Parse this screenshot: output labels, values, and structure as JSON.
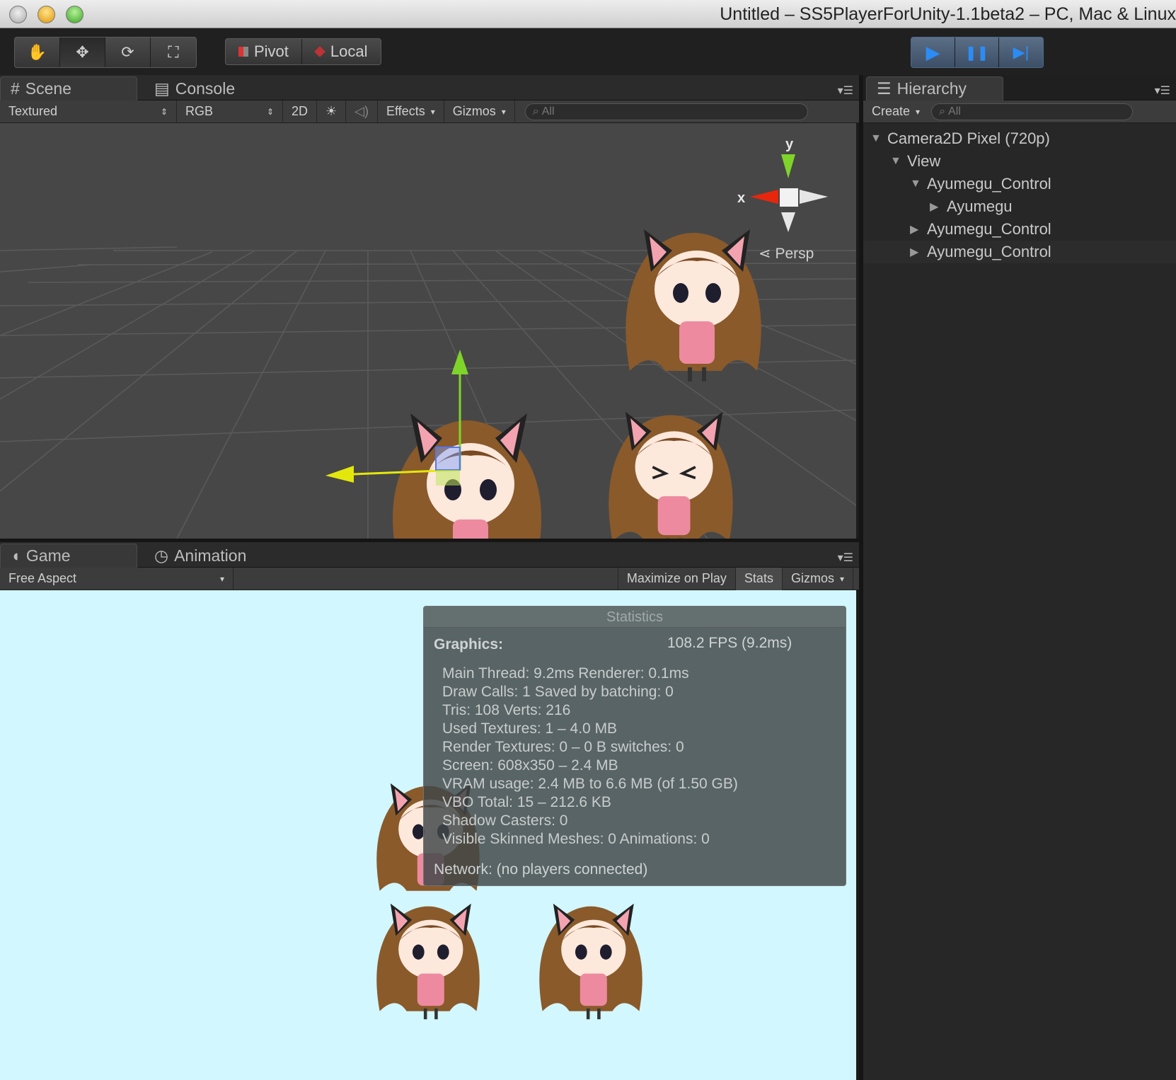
{
  "window": {
    "title": "Untitled – SS5PlayerForUnity-1.1beta2 – PC, Mac & Linux"
  },
  "toolbar": {
    "tools": [
      {
        "name": "hand-tool",
        "glyph": "✋"
      },
      {
        "name": "move-tool",
        "glyph": "✥"
      },
      {
        "name": "rotate-tool",
        "glyph": "⟳"
      },
      {
        "name": "scale-tool",
        "glyph": "⛶"
      }
    ],
    "pivot_label": "Pivot",
    "local_label": "Local",
    "play_glyph": "▶",
    "pause_glyph": "❚❚",
    "step_glyph": "▶|"
  },
  "scene_panel": {
    "tabs": [
      {
        "label": "Scene",
        "icon": "grid-icon",
        "glyph": "#"
      },
      {
        "label": "Console",
        "icon": "console-icon",
        "glyph": "▤"
      }
    ],
    "draw_mode": "Textured",
    "render_mode": "RGB",
    "mode_2d": "2D",
    "lighting_glyph": "☀",
    "audio_glyph": "◁)",
    "effects_label": "Effects",
    "gizmos_label": "Gizmos",
    "search_placeholder": "All",
    "gizmo_y": "y",
    "gizmo_x": "x",
    "persp_label": "Persp"
  },
  "game_panel": {
    "tabs": [
      {
        "label": "Game",
        "icon": "game-icon",
        "glyph": "◖"
      },
      {
        "label": "Animation",
        "icon": "animation-icon",
        "glyph": "◷"
      }
    ],
    "aspect": "Free Aspect",
    "maximize_on_play": "Maximize on Play",
    "stats_label": "Stats",
    "gizmos_label": "Gizmos",
    "background_color": "#d2f7ff"
  },
  "statistics": {
    "title": "Statistics",
    "graphics_label": "Graphics:",
    "fps": "108.2 FPS (9.2ms)",
    "lines": [
      "Main Thread: 9.2ms  Renderer: 0.1ms",
      "Draw Calls: 1  Saved by batching: 0",
      "Tris: 108    Verts: 216",
      "Used Textures: 1 – 4.0 MB",
      "Render Textures: 0 – 0 B   switches: 0",
      "Screen: 608x350 – 2.4 MB",
      "VRAM usage: 2.4 MB to 6.6 MB (of 1.50 GB)",
      "VBO Total: 15 – 212.6 KB",
      "Shadow Casters: 0",
      "Visible Skinned Meshes: 0       Animations: 0"
    ],
    "network": "Network: (no players connected)"
  },
  "hierarchy": {
    "tab_label": "Hierarchy",
    "create_label": "Create",
    "search_placeholder": "All",
    "items": [
      {
        "label": "Camera2D Pixel (720p)",
        "expanded": true
      },
      {
        "label": "View",
        "expanded": true
      },
      {
        "label": "Ayumegu_Control",
        "expanded": true
      },
      {
        "label": "Ayumegu",
        "expanded": false
      },
      {
        "label": "Ayumegu_Control",
        "expanded": false
      },
      {
        "label": "Ayumegu_Control",
        "expanded": false,
        "selected": true
      }
    ]
  },
  "colors": {
    "accent_blue": "#2c8cf5",
    "gizmo_x": "#e8260c",
    "gizmo_y": "#7fd42a",
    "gizmo_z": "#e3e80c"
  }
}
